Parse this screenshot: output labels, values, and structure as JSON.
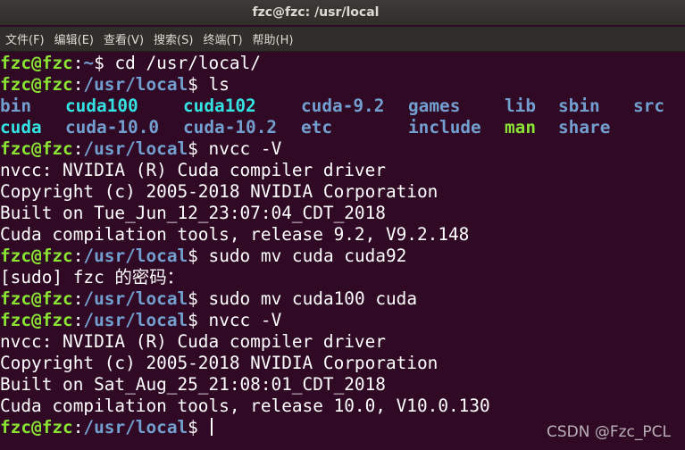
{
  "window": {
    "title": "fzc@fzc: /usr/local"
  },
  "menu": [
    "文件(F)",
    "编辑(E)",
    "查看(V)",
    "搜索(S)",
    "终端(T)",
    "帮助(H)"
  ],
  "colors": {
    "background": "#300a24",
    "prompt_user": "#8ae234",
    "prompt_path": "#729fcf"
  },
  "prompt": {
    "userhost": "fzc@fzc",
    "sep": ":",
    "home": "~",
    "local": "/usr/local",
    "symbol": "$ "
  },
  "cmd1": "cd /usr/local/",
  "cmd2": "ls",
  "ls": {
    "row1": [
      {
        "name": "bin",
        "type": "dir"
      },
      {
        "name": "cuda100",
        "type": "link"
      },
      {
        "name": "cuda102",
        "type": "link"
      },
      {
        "name": "cuda-9.2",
        "type": "dir"
      },
      {
        "name": "games",
        "type": "dir"
      },
      {
        "name": "lib",
        "type": "dir"
      },
      {
        "name": "sbin",
        "type": "dir"
      },
      {
        "name": "src",
        "type": "dir"
      }
    ],
    "row2": [
      {
        "name": "cuda",
        "type": "link"
      },
      {
        "name": "cuda-10.0",
        "type": "dir"
      },
      {
        "name": "cuda-10.2",
        "type": "dir"
      },
      {
        "name": "etc",
        "type": "dir"
      },
      {
        "name": "include",
        "type": "dir"
      },
      {
        "name": "man",
        "type": "exe"
      },
      {
        "name": "share",
        "type": "dir"
      }
    ]
  },
  "cmd3": "nvcc -V",
  "out1": [
    "nvcc: NVIDIA (R) Cuda compiler driver",
    "Copyright (c) 2005-2018 NVIDIA Corporation",
    "Built on Tue_Jun_12_23:07:04_CDT_2018",
    "Cuda compilation tools, release 9.2, V9.2.148"
  ],
  "cmd4": "sudo mv cuda cuda92",
  "sudo_prompt": "[sudo] fzc 的密码：",
  "cmd5": "sudo mv cuda100 cuda",
  "cmd6": "nvcc -V",
  "out2": [
    "nvcc: NVIDIA (R) Cuda compiler driver",
    "Copyright (c) 2005-2018 NVIDIA Corporation",
    "Built on Sat_Aug_25_21:08:01_CDT_2018",
    "Cuda compilation tools, release 10.0, V10.0.130"
  ],
  "watermark": "CSDN @Fzc_PCL"
}
